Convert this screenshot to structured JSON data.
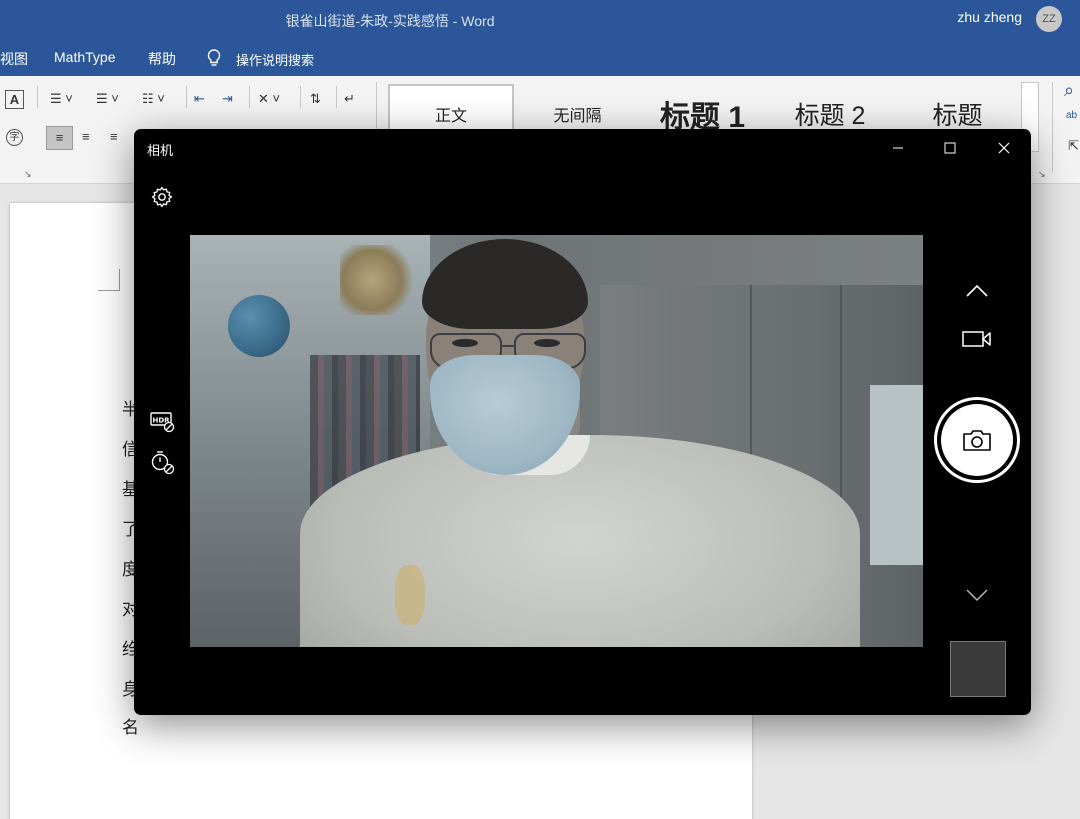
{
  "word": {
    "title": "银雀山街道-朱政-实践感悟  -  Word",
    "user": {
      "name": "zhu zheng",
      "initials": "ZZ"
    },
    "tabs": [
      "视图",
      "MathType",
      "帮助"
    ],
    "tell_me": "操作说明搜索",
    "ribbon": {
      "styles": [
        "正文",
        "无间隔",
        "标题 1",
        "标题 2",
        "标题"
      ]
    },
    "document_chars": [
      "半",
      "信",
      "基",
      "了",
      "度",
      "对",
      "绉",
      "身",
      "名"
    ]
  },
  "camera": {
    "title": "相机",
    "window_controls": {
      "minimize": "minimize",
      "maximize": "maximize",
      "close": "close"
    },
    "icons": {
      "settings": "gear-icon",
      "hdr": "hdr-off-icon",
      "timer": "timer-off-icon",
      "up": "chevron-up-icon",
      "video": "video-camera-icon",
      "shutter": "camera-icon",
      "down": "chevron-down-icon"
    }
  }
}
